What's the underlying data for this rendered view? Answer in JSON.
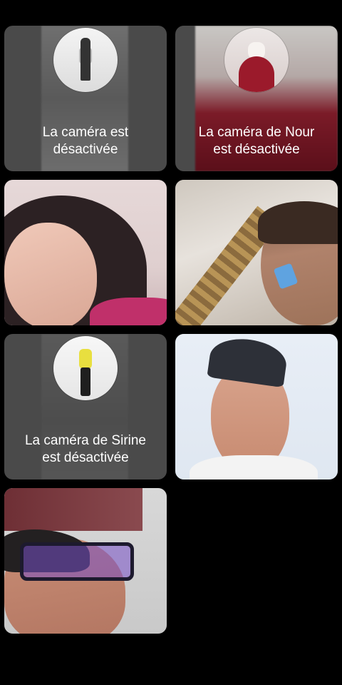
{
  "participants": [
    {
      "id": "p1",
      "camera_off": true,
      "label_line1": "La caméra est",
      "label_line2": "désactivée"
    },
    {
      "id": "p2",
      "camera_off": true,
      "label_line1": "La caméra de Nour",
      "label_line2": "est désactivée"
    },
    {
      "id": "p3",
      "camera_off": false
    },
    {
      "id": "p4",
      "camera_off": false
    },
    {
      "id": "p5",
      "camera_off": true,
      "label_line1": "La caméra de Sirine",
      "label_line2": "est désactivée"
    },
    {
      "id": "p6",
      "camera_off": false
    },
    {
      "id": "p7",
      "camera_off": false
    }
  ],
  "colors": {
    "background": "#000000",
    "tile_off": "#4a4a4a",
    "label_text": "#ffffff"
  }
}
